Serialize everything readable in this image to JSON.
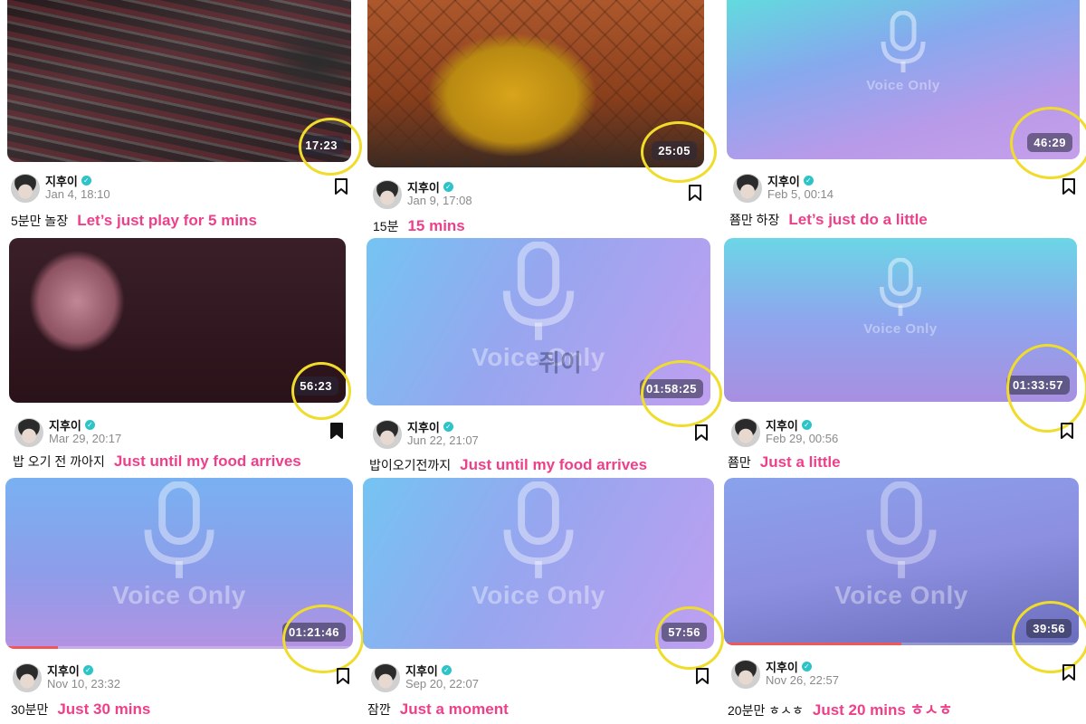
{
  "cards": [
    {
      "author": "지후이",
      "date": "Jan 4, 18:10",
      "duration": "17:23",
      "caption_ko": "5분만 놀장",
      "caption_en": "Let’s just play for 5 mins",
      "bookmarked": false
    },
    {
      "author": "지후이",
      "date": "Jan 9, 17:08",
      "duration": "25:05",
      "caption_ko": "15분",
      "caption_en": "15 mins",
      "bookmarked": false
    },
    {
      "author": "지후이",
      "date": "Feb 5, 00:14",
      "duration": "46:29",
      "caption_ko": "쬼만 하장",
      "caption_en": "Let’s just do a little",
      "bookmarked": false,
      "voice_label": "Voice Only"
    },
    {
      "author": "지후이",
      "date": "Mar 29, 20:17",
      "duration": "56:23",
      "caption_ko": "밥 오기 전 까아지",
      "caption_en": "Just until my food arrives",
      "bookmarked": true
    },
    {
      "author": "지후이",
      "date": "Jun 22, 21:07",
      "duration": "01:58:25",
      "caption_ko": "밥이오기전까지",
      "caption_en": "Just until my food arrives",
      "bookmarked": false,
      "voice_label": "Voice Only",
      "watermark": "쥐이"
    },
    {
      "author": "지후이",
      "date": "Feb 29, 00:56",
      "duration": "01:33:57",
      "caption_ko": "쬼만",
      "caption_en": "Just a little",
      "bookmarked": false,
      "voice_label": "Voice Only"
    },
    {
      "author": "지후이",
      "date": "Nov 10, 23:32",
      "duration": "01:21:46",
      "caption_ko": "30분만",
      "caption_en": "Just 30 mins",
      "bookmarked": false,
      "voice_label": "Voice Only",
      "progress": 0.15
    },
    {
      "author": "지후이",
      "date": "Sep 20, 22:07",
      "duration": "57:56",
      "caption_ko": "잠깐",
      "caption_en": "Just a moment",
      "bookmarked": false,
      "voice_label": "Voice Only"
    },
    {
      "author": "지후이",
      "date": "Nov 26, 22:57",
      "duration": "39:56",
      "caption_ko": "20분만 ㅎㅅㅎ",
      "caption_en": "Just 20 mins ㅎㅅㅎ",
      "bookmarked": false,
      "voice_label": "Voice Only",
      "progress": 0.5
    }
  ],
  "colors": {
    "caption_accent": "#ee3f8a",
    "highlight_ring": "#f0dc2a",
    "verified_badge": "#2dc4c8",
    "progress": "#f0565a"
  },
  "icons": [
    "mic-icon",
    "verified-icon",
    "bookmark-icon",
    "bookmark-filled-icon"
  ]
}
